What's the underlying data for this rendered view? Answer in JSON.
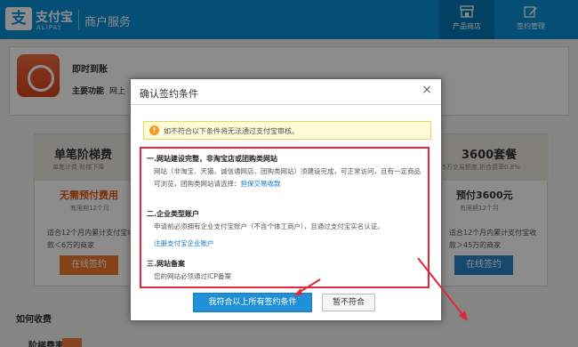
{
  "header": {
    "logo_char": "支",
    "logo_name": "支付宝",
    "logo_sub": "ALIPAY",
    "title": "商户服务",
    "nav": [
      {
        "label": "产品商店",
        "icon": "store-icon",
        "active": true
      },
      {
        "label": "签约管理",
        "icon": "edit-icon",
        "active": false
      }
    ]
  },
  "product": {
    "name": "即时到账",
    "func_label": "主要功能",
    "func_value": "网上"
  },
  "plans": [
    {
      "name": "单笔阶梯费",
      "sub": "单笔计费 阶梯下降",
      "price": "无需预付费用",
      "period": "有限期12个月",
      "desc1": "适合12个月内累计支付宝收",
      "desc2": "款＜6万的商家",
      "button": "在线签约"
    },
    {
      "name": "3600套餐",
      "sub": "45万交易额度,折合费率0.8%",
      "price": "预付3600元",
      "period": "有限期12个月",
      "desc1": "适合12个月内累计支付宝收",
      "desc2": "款＞45万的商家",
      "button": "在线签约"
    }
  ],
  "how": {
    "title": "如何收费",
    "step": "阶梯费率"
  },
  "modal": {
    "title": "确认签约条件",
    "close": "×",
    "warn_icon": "!",
    "warn": "如不符合以下条件将无法通过支付宝审核。",
    "conditions": [
      {
        "title": "一.网站建设完整，非淘宝店或团购类网站",
        "lines": [
          "网站（非淘宝、天猫、诚信通网店、团购类网站）须建设完成，可正常访问，且有一定商品",
          "可浏览，团购类网站请选择："
        ],
        "link": "担保交易收款"
      },
      {
        "title": "二.企业类型账户",
        "lines": [
          "申请前必须拥有企业支付宝账户（不含个体工商户），且通过支付宝实名认证。"
        ],
        "link": "注册支付宝企业账户"
      },
      {
        "title": "三.网站备案",
        "lines": [
          "您的网站必须通过ICP备案"
        ],
        "link": ""
      }
    ],
    "btn_primary": "我符合以上所有签约条件",
    "btn_secondary": "暂不符合"
  },
  "colors": {
    "brand": "#0a8fd8",
    "highlight": "#e0283c",
    "accent": "#e2590f"
  }
}
